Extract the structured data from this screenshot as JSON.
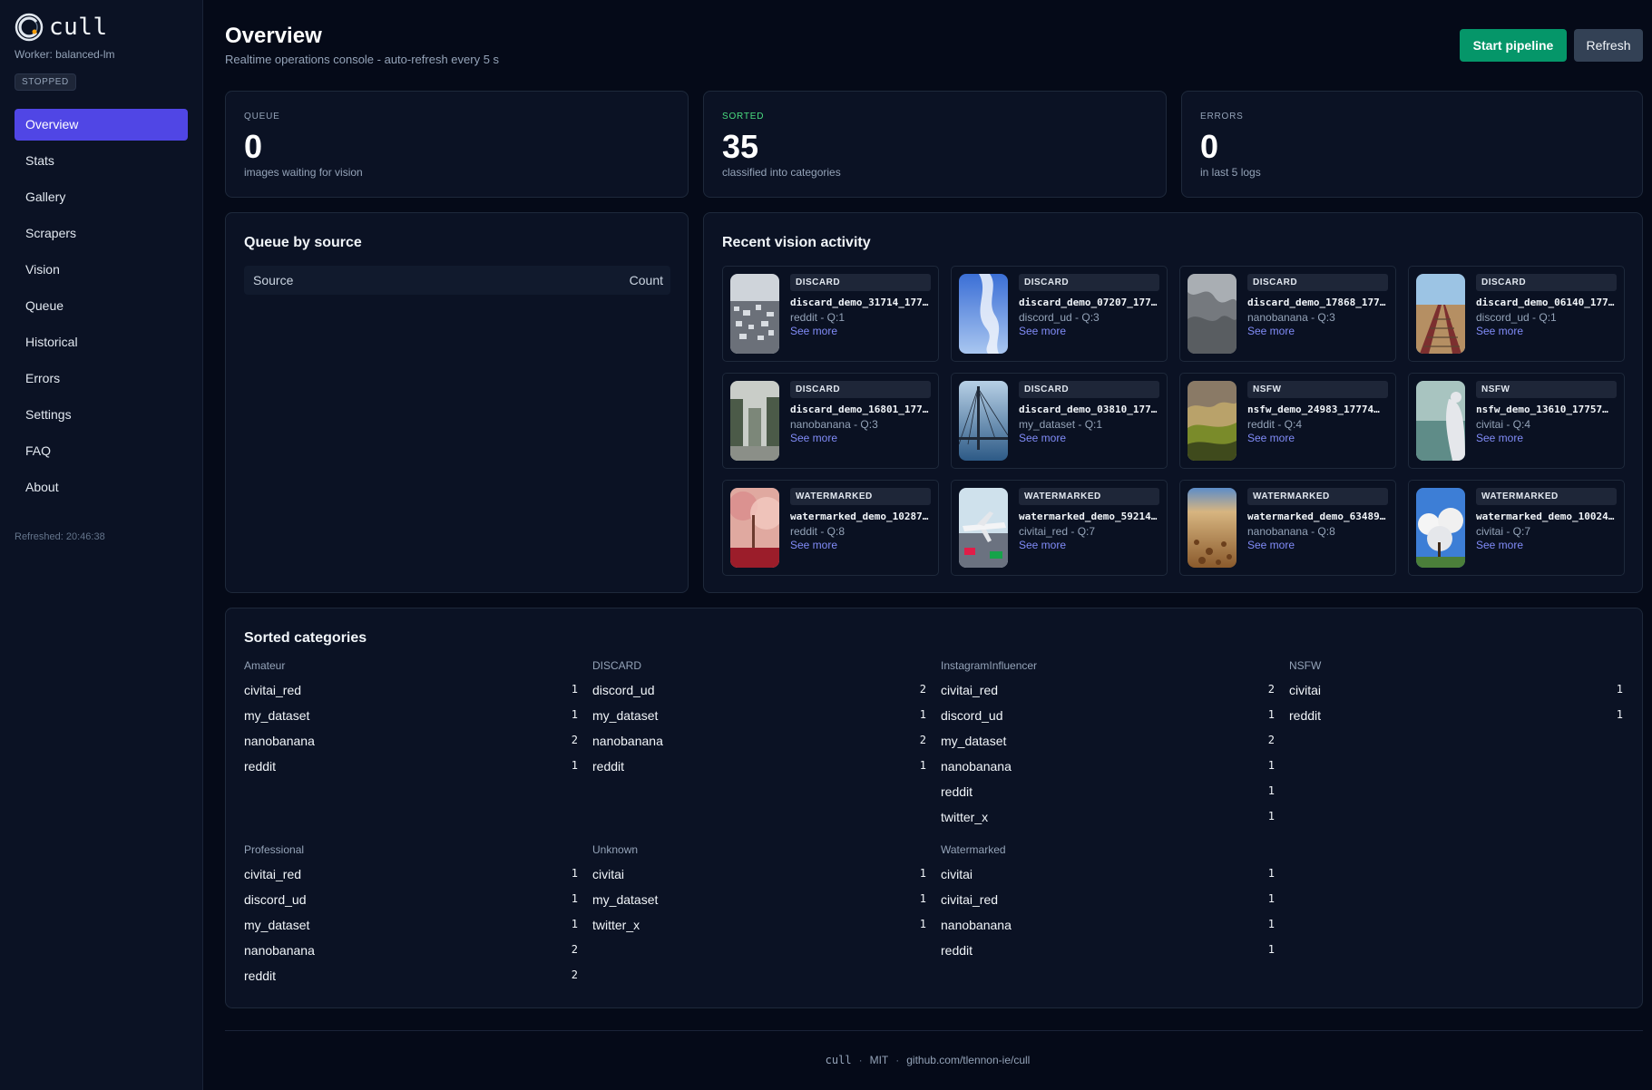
{
  "app": {
    "name": "cull",
    "worker": "Worker: balanced-lm",
    "status": "STOPPED",
    "refreshed": "Refreshed: 20:46:38"
  },
  "nav": [
    {
      "label": "Overview",
      "active": true
    },
    {
      "label": "Stats"
    },
    {
      "label": "Gallery"
    },
    {
      "label": "Scrapers"
    },
    {
      "label": "Vision"
    },
    {
      "label": "Queue"
    },
    {
      "label": "Historical"
    },
    {
      "label": "Errors"
    },
    {
      "label": "Settings"
    },
    {
      "label": "FAQ"
    },
    {
      "label": "About"
    }
  ],
  "header": {
    "title": "Overview",
    "subtitle": "Realtime operations console - auto-refresh every 5 s",
    "start_label": "Start pipeline",
    "refresh_label": "Refresh"
  },
  "stats": {
    "queue": {
      "label": "QUEUE",
      "value": "0",
      "desc": "images waiting for vision",
      "color": "#94a3b8"
    },
    "sorted": {
      "label": "SORTED",
      "value": "35",
      "desc": "classified into categories",
      "color": "#4ade80"
    },
    "errors": {
      "label": "ERRORS",
      "value": "0",
      "desc": "in last 5 logs",
      "color": "#94a3b8"
    }
  },
  "queue_by_source": {
    "title": "Queue by source",
    "col_source": "Source",
    "col_count": "Count"
  },
  "activity": {
    "title": "Recent vision activity",
    "see_more": "See more",
    "items": [
      {
        "badge": "DISCARD",
        "file": "discard_demo_31714_177…",
        "meta": "reddit - Q:1",
        "thumb": "city"
      },
      {
        "badge": "DISCARD",
        "file": "discard_demo_07207_177…",
        "meta": "discord_ud - Q:3",
        "thumb": "sky"
      },
      {
        "badge": "DISCARD",
        "file": "discard_demo_17868_177…",
        "meta": "nanobanana - Q:3",
        "thumb": "mist"
      },
      {
        "badge": "DISCARD",
        "file": "discard_demo_06140_177…",
        "meta": "discord_ud - Q:1",
        "thumb": "rail"
      },
      {
        "badge": "DISCARD",
        "file": "discard_demo_16801_177…",
        "meta": "nanobanana - Q:3",
        "thumb": "fog"
      },
      {
        "badge": "DISCARD",
        "file": "discard_demo_03810_177…",
        "meta": "my_dataset - Q:1",
        "thumb": "bridge"
      },
      {
        "badge": "NSFW",
        "file": "nsfw_demo_24983_17774…",
        "meta": "reddit - Q:4",
        "thumb": "hills"
      },
      {
        "badge": "NSFW",
        "file": "nsfw_demo_13610_17757…",
        "meta": "civitai - Q:4",
        "thumb": "sea"
      },
      {
        "badge": "WATERMARKED",
        "file": "watermarked_demo_10287…",
        "meta": "reddit - Q:8",
        "thumb": "autumn"
      },
      {
        "badge": "WATERMARKED",
        "file": "watermarked_demo_59214…",
        "meta": "civitai_red - Q:7",
        "thumb": "plane"
      },
      {
        "badge": "WATERMARKED",
        "file": "watermarked_demo_63489…",
        "meta": "nanobanana - Q:8",
        "thumb": "pebbles"
      },
      {
        "badge": "WATERMARKED",
        "file": "watermarked_demo_10024…",
        "meta": "civitai - Q:7",
        "thumb": "blossom"
      }
    ]
  },
  "sorted_categories": {
    "title": "Sorted categories",
    "groups": [
      {
        "name": "Amateur",
        "rows": [
          {
            "source": "civitai_red",
            "count": "1"
          },
          {
            "source": "my_dataset",
            "count": "1"
          },
          {
            "source": "nanobanana",
            "count": "2"
          },
          {
            "source": "reddit",
            "count": "1"
          }
        ]
      },
      {
        "name": "DISCARD",
        "rows": [
          {
            "source": "discord_ud",
            "count": "2"
          },
          {
            "source": "my_dataset",
            "count": "1"
          },
          {
            "source": "nanobanana",
            "count": "2"
          },
          {
            "source": "reddit",
            "count": "1"
          }
        ]
      },
      {
        "name": "InstagramInfluencer",
        "rows": [
          {
            "source": "civitai_red",
            "count": "2"
          },
          {
            "source": "discord_ud",
            "count": "1"
          },
          {
            "source": "my_dataset",
            "count": "2"
          },
          {
            "source": "nanobanana",
            "count": "1"
          },
          {
            "source": "reddit",
            "count": "1"
          },
          {
            "source": "twitter_x",
            "count": "1"
          }
        ]
      },
      {
        "name": "NSFW",
        "rows": [
          {
            "source": "civitai",
            "count": "1"
          },
          {
            "source": "reddit",
            "count": "1"
          }
        ]
      },
      {
        "name": "Professional",
        "rows": [
          {
            "source": "civitai_red",
            "count": "1"
          },
          {
            "source": "discord_ud",
            "count": "1"
          },
          {
            "source": "my_dataset",
            "count": "1"
          },
          {
            "source": "nanobanana",
            "count": "2"
          },
          {
            "source": "reddit",
            "count": "2"
          }
        ]
      },
      {
        "name": "Unknown",
        "rows": [
          {
            "source": "civitai",
            "count": "1"
          },
          {
            "source": "my_dataset",
            "count": "1"
          },
          {
            "source": "twitter_x",
            "count": "1"
          }
        ]
      },
      {
        "name": "Watermarked",
        "rows": [
          {
            "source": "civitai",
            "count": "1"
          },
          {
            "source": "civitai_red",
            "count": "1"
          },
          {
            "source": "nanobanana",
            "count": "1"
          },
          {
            "source": "reddit",
            "count": "1"
          }
        ]
      }
    ]
  },
  "footer": {
    "app": "cull",
    "license": "MIT",
    "repo": "github.com/tlennon-ie/cull"
  }
}
